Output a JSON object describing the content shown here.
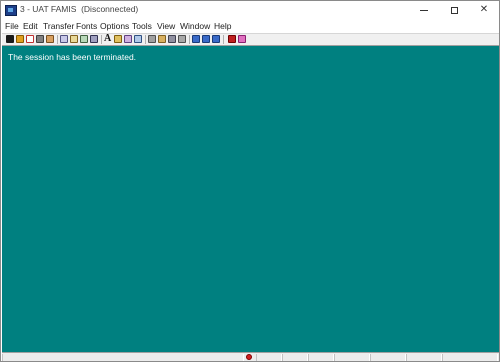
{
  "window": {
    "title": "3 - UAT FAMIS  (Disconnected)"
  },
  "menu": {
    "items": [
      "File",
      "Edit",
      "Transfer",
      "Fonts",
      "Options",
      "Tools",
      "View",
      "Window",
      "Help"
    ]
  },
  "toolbar": {
    "icons": [
      "connect-icon",
      "open-session-icon",
      "new-session-icon",
      "print-icon",
      "print-screen-icon",
      "macro-icon",
      "edit-macro-icon",
      "run-macro-icon",
      "keyboard-map-icon",
      "font-icon",
      "color-icon",
      "hotspot-icon",
      "copy-icon",
      "cut-icon",
      "paste-icon",
      "send-file-icon",
      "receive-file-icon",
      "transfer-list-icon",
      "return-icon",
      "eraser-icon"
    ],
    "font_glyph": "A"
  },
  "screen": {
    "message": "The session has been terminated.",
    "background": "#008080",
    "text_color": "#ffffff"
  },
  "colors": {
    "accent": "#008080",
    "status_indicator": "#d02020"
  }
}
